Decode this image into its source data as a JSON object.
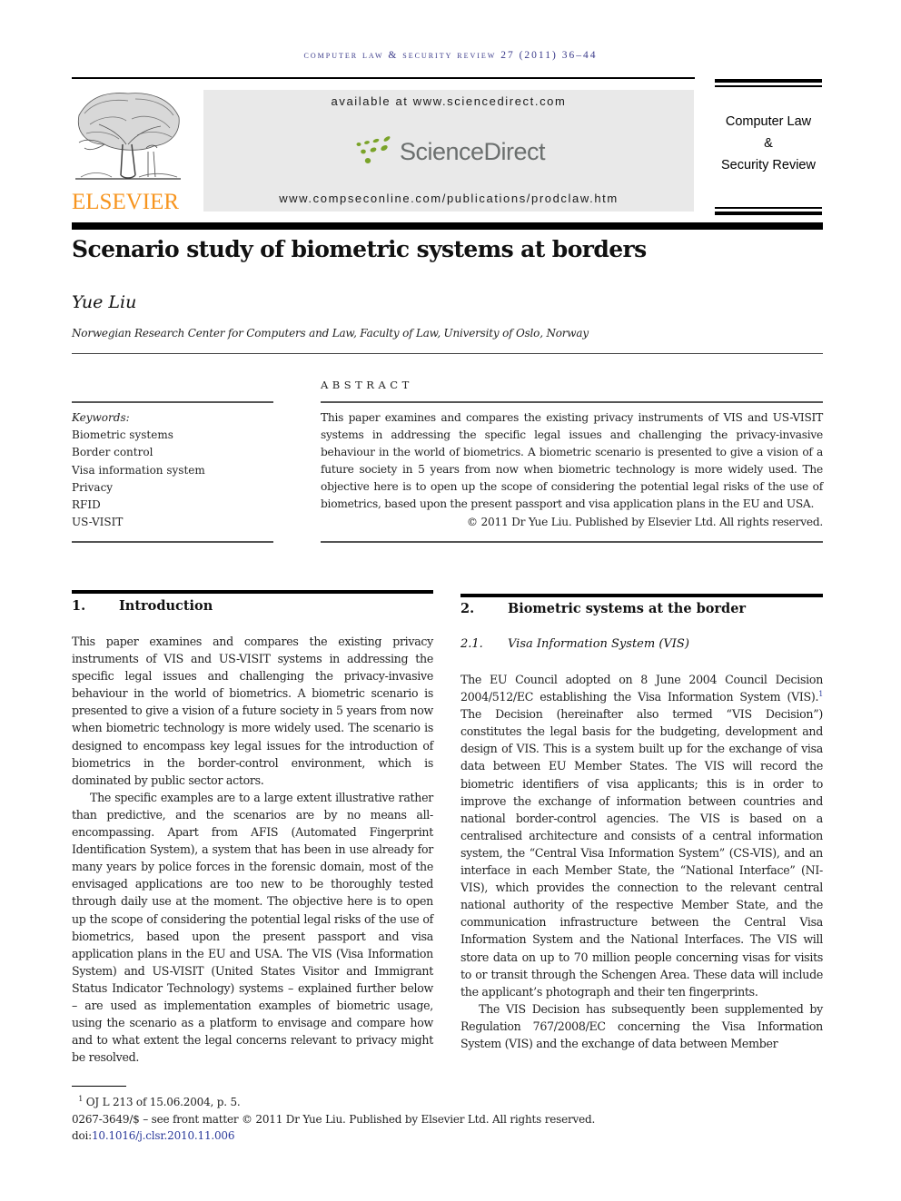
{
  "running_head": "computer law & security review 27 (2011) 36–44",
  "publisher": {
    "logo_name": "ELSEVIER",
    "logo_color": "#f7941d"
  },
  "sciencedirect": {
    "available_text": "available at www.sciencedirect.com",
    "brand": "ScienceDirect",
    "brand_dot_color": "#7aa329",
    "journal_url": "www.compseconline.com/publications/prodclaw.htm"
  },
  "journal": {
    "line1": "Computer Law",
    "line2": "&",
    "line3": "Security Review"
  },
  "article": {
    "title": "Scenario study of biometric systems at borders",
    "author": "Yue Liu",
    "affiliation": "Norwegian Research Center for Computers and Law, Faculty of Law, University of Oslo, Norway"
  },
  "abstract": {
    "heading": "ABSTRACT",
    "text": "This paper examines and compares the existing privacy instruments of VIS and US-VISIT systems in addressing the specific legal issues and challenging the privacy-invasive behaviour in the world of biometrics. A biometric scenario is presented to give a vision of a future society in 5 years from now when biometric technology is more widely used. The objective here is to open up the scope of considering the potential legal risks of the use of biometrics, based upon the present passport and visa application plans in the EU and USA.",
    "copyright": "© 2011 Dr Yue Liu. Published by Elsevier Ltd. All rights reserved."
  },
  "keywords": {
    "heading": "Keywords:",
    "items": [
      "Biometric systems",
      "Border control",
      "Visa information system",
      "Privacy",
      "RFID",
      "US-VISIT"
    ]
  },
  "sections": {
    "intro": {
      "number": "1.",
      "title": "Introduction",
      "paragraphs": [
        "This paper examines and compares the existing privacy instruments of VIS and US-VISIT systems in addressing the specific legal issues and challenging the privacy-invasive behaviour in the world of biometrics. A biometric scenario is presented to give a vision of a future society in 5 years from now when biometric technology is more widely used. The scenario is designed to encompass key legal issues for the introduction of biometrics in the border-control environment, which is dominated by public sector actors.",
        "The specific examples are to a large extent illustrative rather than predictive, and the scenarios are by no means all-encompassing. Apart from AFIS (Automated Fingerprint Identification System), a system that has been in use already for many years by police forces in the forensic domain, most of the envisaged applications are too new to be thoroughly tested through daily use at the moment. The objective here is to open up the scope of considering the potential legal risks of the use of biometrics, based upon the present passport and visa application plans in the EU and USA. The VIS (Visa Information System) and US-VISIT (United States Visitor and Immigrant Status Indicator Technology) systems – explained further below – are used as implementation examples of biometric usage, using the scenario as a platform to envisage and compare how and to what extent the legal concerns relevant to privacy might be resolved."
      ]
    },
    "border": {
      "number": "2.",
      "title": "Biometric systems at the border",
      "subsection": {
        "number": "2.1.",
        "title": "Visa Information System (VIS)"
      },
      "p1_before_ref": "The EU Council adopted on 8 June 2004 Council Decision 2004/512/EC establishing the Visa Information System (VIS).",
      "p1_ref": "1",
      "p1_after_ref": " The Decision (hereinafter also termed “VIS Decision”) constitutes the legal basis for the budgeting, development and design of VIS. This is a system built up for the exchange of visa data between EU Member States. The VIS will record the biometric identifiers of visa applicants; this is in order to improve the exchange of information between countries and national border-control agencies. The VIS is based on a centralised architecture and consists of a central information system, the “Central Visa Information System” (CS-VIS), and an interface in each Member State, the “National Interface” (NI-VIS), which provides the connection to the relevant central national authority of the respective Member State, and the communication infrastructure between the Central Visa Information System and the National Interfaces. The VIS will store data on up to 70 million people concerning visas for visits to or transit through the Schengen Area. These data will include the applicant’s photograph and their ten fingerprints.",
      "p2": "The VIS Decision has subsequently been supplemented by Regulation 767/2008/EC concerning the Visa Information System (VIS) and the exchange of data between Member"
    }
  },
  "footer": {
    "footnote_mark": "1",
    "footnote_text": "OJ L 213 of 15.06.2004, p. 5.",
    "issn_line": "0267-3649/$ – see front matter © 2011 Dr Yue Liu. Published by Elsevier Ltd. All rights reserved.",
    "doi_label": "doi:",
    "doi_value": "10.1016/j.clsr.2010.11.006"
  }
}
